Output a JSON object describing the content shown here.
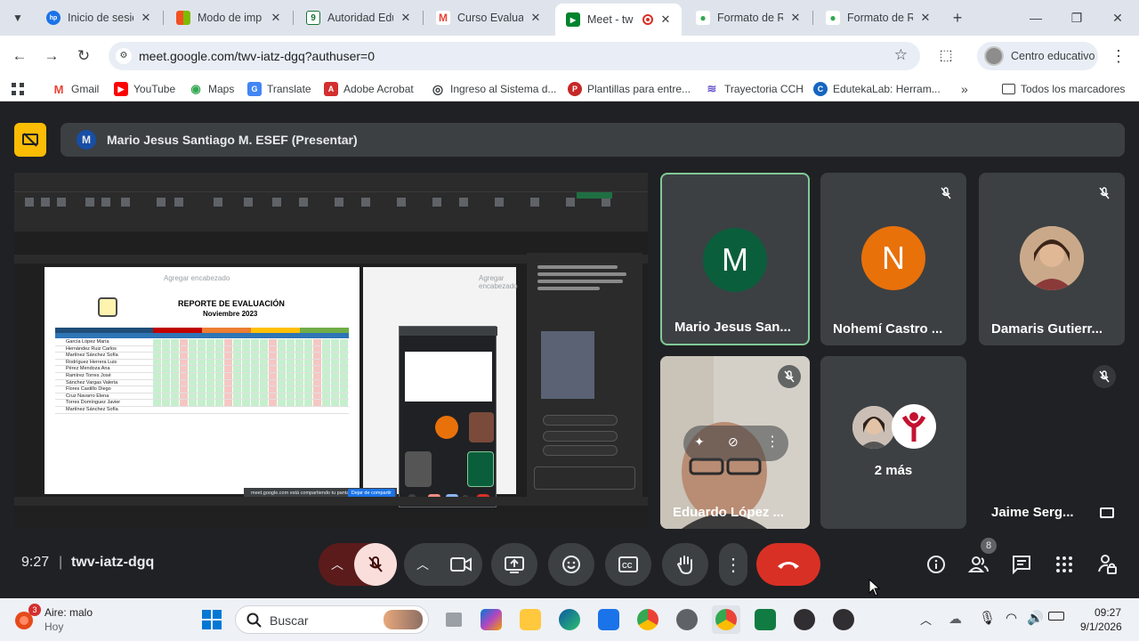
{
  "browser": {
    "tabs": [
      {
        "title": "Inicio de sesió",
        "color": "#1a73e8",
        "glyph": "hp"
      },
      {
        "title": "Modo de imp",
        "color": "#f25022",
        "glyph": "■"
      },
      {
        "title": "Autoridad Edu",
        "color": "#137333",
        "glyph": "9"
      },
      {
        "title": "Curso Evaluaci",
        "color": "#ea4335",
        "glyph": "M"
      },
      {
        "title": "Meet - tw",
        "color": "#00832d",
        "glyph": "▶",
        "active": true
      },
      {
        "title": "Formato de R",
        "color": "#34a853",
        "glyph": "●"
      },
      {
        "title": "Formato de R",
        "color": "#34a853",
        "glyph": "●"
      }
    ],
    "url": "meet.google.com/twv-iatz-dgq?authuser=0",
    "profile_name": "Centro educativo",
    "bookmarks": [
      {
        "label": "Gmail",
        "color": "#ea4335",
        "glyph": "M"
      },
      {
        "label": "YouTube",
        "color": "#ff0000",
        "glyph": "▶"
      },
      {
        "label": "Maps",
        "color": "#34a853",
        "glyph": "◉"
      },
      {
        "label": "Translate",
        "color": "#4285f4",
        "glyph": "G"
      },
      {
        "label": "Adobe Acrobat",
        "color": "#d32f2f",
        "glyph": "A"
      },
      {
        "label": "Ingreso al Sistema d...",
        "color": "#3c4043",
        "glyph": "◎"
      },
      {
        "label": "Plantillas para entre...",
        "color": "#c62828",
        "glyph": "P"
      },
      {
        "label": "Trayectoria CCH",
        "color": "#6a5acd",
        "glyph": "≋"
      },
      {
        "label": "EdutekaLab: Herram...",
        "color": "#1565c0",
        "glyph": "C"
      }
    ],
    "all_bookmarks": "Todos los marcadores"
  },
  "meet": {
    "presenter_initial": "M",
    "presenting_label": "Mario Jesus Santiago M. ESEF (Presentar)",
    "shared_screen": {
      "header_placeholder": "Agregar encabezado",
      "report_title": "REPORTE DE EVALUACIÓN",
      "report_subtitle": "Noviembre 2023",
      "students": [
        "García López María",
        "Hernández Ruiz Carlos",
        "Martínez Sánchez Sofía",
        "Rodríguez Herrera Luis",
        "Pérez Mendoza Ana",
        "Ramírez Torres José",
        "Sánchez Vargas Valeria",
        "Flores Castillo Diego",
        "Cruz Navarro Elena",
        "Torres Domínguez Javier",
        "Martínez Sánchez Sofía"
      ],
      "share_notice": "meet.google.com está compartiendo tu pantalla.",
      "stop_share": "Dejar de compartir"
    },
    "participants": [
      {
        "name": "Mario Jesus San...",
        "initial": "M",
        "color": "#0b5e3c",
        "speaking": true,
        "muted": false
      },
      {
        "name": "Nohemí Castro ...",
        "initial": "N",
        "color": "#e8710a",
        "muted": true
      },
      {
        "name": "Damaris Gutierr...",
        "initial": "",
        "muted": true
      },
      {
        "name": "Eduardo López ...",
        "initial": "",
        "muted": true
      },
      {
        "name": "2 más",
        "initial": "",
        "muted": false
      },
      {
        "name": "Jaime Serg...",
        "initial": "",
        "muted": true
      }
    ],
    "clock": "9:27",
    "separator": "|",
    "meeting_code": "twv-iatz-dgq",
    "people_count": "8"
  },
  "taskbar": {
    "weather_temp_badge": "3",
    "weather_title": "Aire: malo",
    "weather_sub": "Hoy",
    "search_placeholder": "Buscar",
    "time": "09:27",
    "date": "9/1/2026"
  }
}
